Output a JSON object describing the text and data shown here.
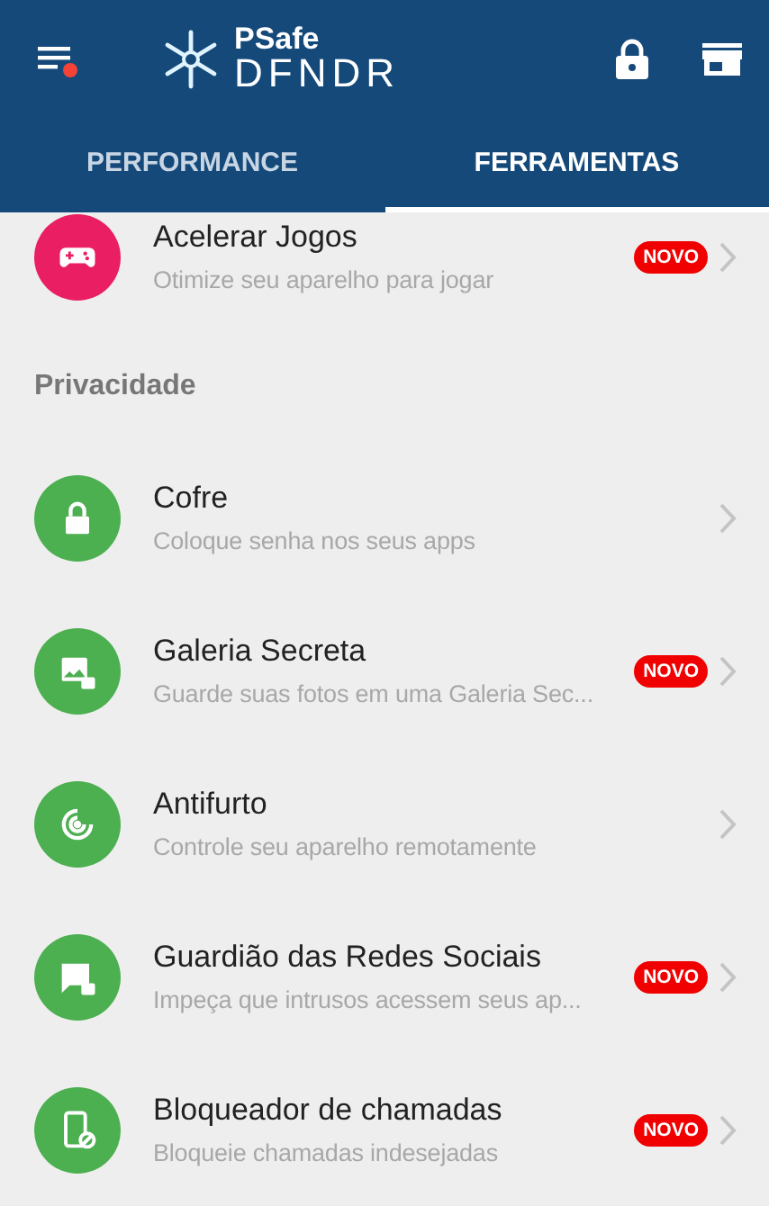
{
  "header": {
    "logo_top": "PSafe",
    "logo_bottom": "DFNDR",
    "menu_has_notification": true
  },
  "tabs": [
    {
      "label": "PERFORMANCE",
      "selected": false
    },
    {
      "label": "FERRAMENTAS",
      "selected": true
    }
  ],
  "list": [
    {
      "kind": "tool",
      "title": "Acelerar Jogos",
      "subtitle": "Otimize seu aparelho para jogar",
      "badge": "NOVO",
      "color": "#e91e63"
    },
    {
      "kind": "header",
      "title": "Privacidade"
    },
    {
      "kind": "tool",
      "title": "Cofre",
      "subtitle": "Coloque senha nos seus apps",
      "color": "#4caf50"
    },
    {
      "kind": "tool",
      "title": "Galeria Secreta",
      "subtitle": "Guarde suas fotos em uma Galeria Sec...",
      "badge": "NOVO",
      "color": "#4caf50"
    },
    {
      "kind": "tool",
      "title": "Antifurto",
      "subtitle": "Controle seu aparelho remotamente",
      "color": "#4caf50"
    },
    {
      "kind": "tool",
      "title": "Guardião das Redes Sociais",
      "subtitle": "Impeça que intrusos acessem seus ap...",
      "badge": "NOVO",
      "color": "#4caf50"
    },
    {
      "kind": "tool",
      "title": "Bloqueador de chamadas",
      "subtitle": "Bloqueie chamadas indesejadas",
      "badge": "NOVO",
      "color": "#4caf50"
    }
  ]
}
